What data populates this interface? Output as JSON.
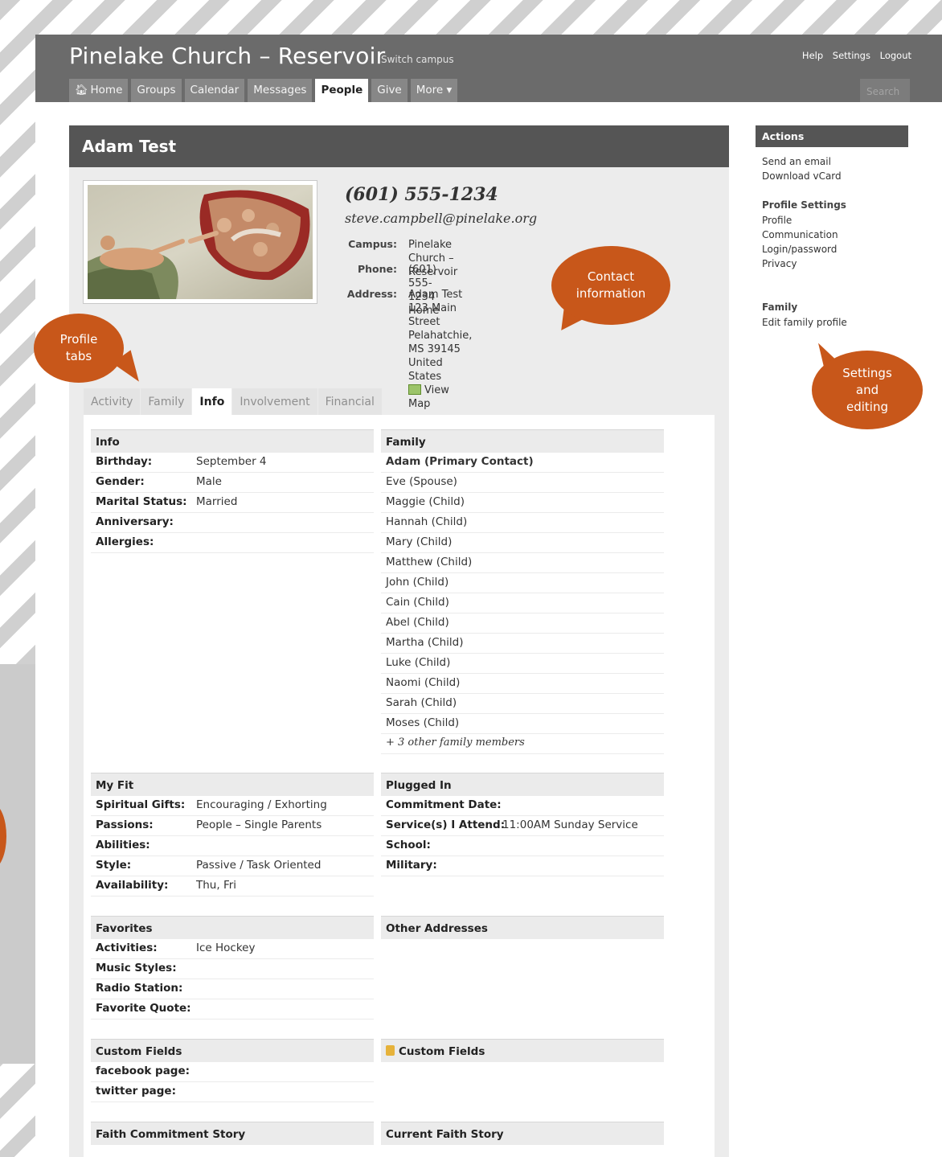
{
  "header": {
    "site_title": "Pinelake Church – Reservoir",
    "switch_campus": "Switch campus",
    "top_links": [
      "Help",
      "Settings",
      "Logout"
    ],
    "search_placeholder": "Search"
  },
  "nav": {
    "tabs": [
      {
        "label": "Home",
        "icon": "home-icon"
      },
      {
        "label": "Groups"
      },
      {
        "label": "Calendar"
      },
      {
        "label": "Messages"
      },
      {
        "label": "People",
        "active": true
      },
      {
        "label": "Give"
      },
      {
        "label": "More ▾"
      }
    ]
  },
  "profile": {
    "name": "Adam Test",
    "phone_big": "(601) 555-1234",
    "email_big": "steve.campbell@pinelake.org",
    "campus_label": "Campus:",
    "campus": "Pinelake Church – Reservoir",
    "phone_label": "Phone:",
    "phone": "(601) 555-1234 Home",
    "address_label": "Address:",
    "address_lines": [
      "Adam Test",
      "123 Main Street",
      "Pelahatchie, MS 39145",
      "United States"
    ],
    "view_map": "View Map"
  },
  "tabs": [
    "Activity",
    "Family",
    "Info",
    "Involvement",
    "Financial"
  ],
  "active_tab": "Info",
  "info": {
    "title": "Info",
    "rows": [
      {
        "label": "Birthday:",
        "value": "September 4"
      },
      {
        "label": "Gender:",
        "value": "Male"
      },
      {
        "label": "Marital Status:",
        "value": "Married"
      },
      {
        "label": "Anniversary:",
        "value": ""
      },
      {
        "label": "Allergies:",
        "value": ""
      }
    ]
  },
  "family": {
    "title": "Family",
    "primary": "Adam (Primary Contact)",
    "members": [
      "Eve (Spouse)",
      "Maggie (Child)",
      "Hannah (Child)",
      "Mary (Child)",
      "Matthew (Child)",
      "John (Child)",
      "Cain (Child)",
      "Abel (Child)",
      "Martha (Child)",
      "Luke (Child)",
      "Naomi (Child)",
      "Sarah (Child)",
      "Moses (Child)"
    ],
    "more": "+ 3 other family members"
  },
  "my_fit": {
    "title": "My Fit",
    "rows": [
      {
        "label": "Spiritual Gifts:",
        "value": "Encouraging / Exhorting"
      },
      {
        "label": "Passions:",
        "value": "People – Single Parents"
      },
      {
        "label": "Abilities:",
        "value": ""
      },
      {
        "label": "Style:",
        "value": "Passive / Task Oriented"
      },
      {
        "label": "Availability:",
        "value": "Thu, Fri"
      }
    ]
  },
  "plugged_in": {
    "title": "Plugged In",
    "rows": [
      {
        "label": "Commitment Date:",
        "value": ""
      },
      {
        "label": "Service(s) I Attend:",
        "value": "11:00AM Sunday Service"
      },
      {
        "label": "School:",
        "value": ""
      },
      {
        "label": "Military:",
        "value": ""
      }
    ]
  },
  "favorites": {
    "title": "Favorites",
    "rows": [
      {
        "label": "Activities:",
        "value": "Ice Hockey"
      },
      {
        "label": "Music Styles:",
        "value": ""
      },
      {
        "label": "Radio Station:",
        "value": ""
      },
      {
        "label": "Favorite Quote:",
        "value": ""
      }
    ]
  },
  "other_addresses": {
    "title": "Other Addresses"
  },
  "custom_fields": {
    "title": "Custom Fields",
    "rows": [
      {
        "label": "facebook page:",
        "value": ""
      },
      {
        "label": "twitter page:",
        "value": ""
      }
    ]
  },
  "custom_fields_private": {
    "title": "Custom Fields",
    "icon": "lock-icon"
  },
  "faith_commitment": {
    "title": "Faith Commitment Story"
  },
  "current_faith": {
    "title": "Current Faith Story"
  },
  "actions": {
    "title": "Actions",
    "group1": [
      "Send an email",
      "Download vCard"
    ],
    "profile_settings_title": "Profile Settings",
    "profile_settings": [
      "Profile",
      "Communication",
      "Login/password",
      "Privacy"
    ],
    "family_title": "Family",
    "family_links": [
      "Edit family profile"
    ]
  },
  "callouts": {
    "contact": "Contact information",
    "tabs": "Profile tabs",
    "settings": "Settings and editing"
  },
  "colors": {
    "callout": "#c8571a",
    "header": "#6b6b6b",
    "name_bar": "#555555"
  }
}
